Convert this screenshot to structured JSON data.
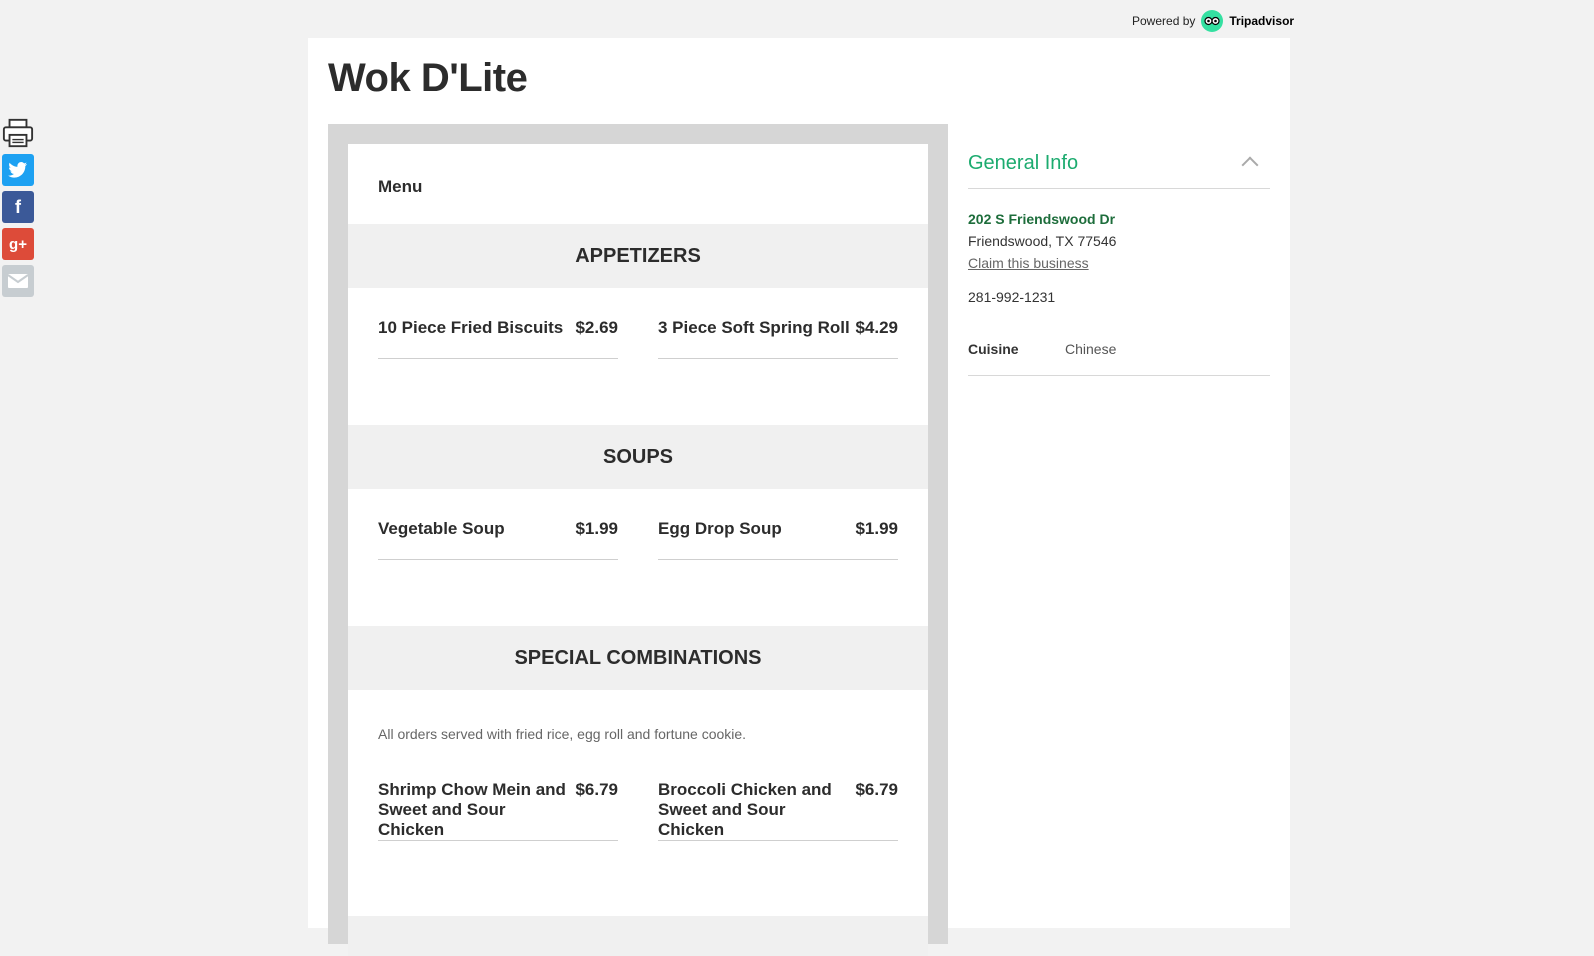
{
  "powered_by": {
    "label": "Powered by",
    "brand": "Tripadvisor"
  },
  "share": {
    "icons": [
      "printer-icon",
      "twitter-icon",
      "facebook-icon",
      "google-plus-icon",
      "email-icon"
    ],
    "twitter_glyph": "t",
    "facebook_glyph": "f",
    "googleplus_glyph": "g+"
  },
  "restaurant": {
    "name": "Wok D'Lite"
  },
  "menu": {
    "label": "Menu",
    "sections": [
      {
        "title": "APPETIZERS",
        "items": [
          {
            "name": "10 Piece Fried Biscuits",
            "price": "$2.69"
          },
          {
            "name": "3 Piece Soft Spring Roll",
            "price": "$4.29"
          }
        ]
      },
      {
        "title": "SOUPS",
        "items": [
          {
            "name": "Vegetable Soup",
            "price": "$1.99"
          },
          {
            "name": "Egg Drop Soup",
            "price": "$1.99"
          }
        ]
      },
      {
        "title": "SPECIAL COMBINATIONS",
        "note": "All orders served with fried rice, egg roll and fortune cookie.",
        "items": [
          {
            "name": "Shrimp Chow Mein and Sweet and Sour Chicken",
            "price": "$6.79"
          },
          {
            "name": "Broccoli Chicken and Sweet and Sour Chicken",
            "price": "$6.79"
          }
        ]
      }
    ]
  },
  "general_info": {
    "title": "General Info",
    "address_line1": "202 S Friendswood Dr",
    "address_line2": "Friendswood, TX 77546",
    "claim_link": "Claim this business",
    "phone": "281-992-1231",
    "cuisine_label": "Cuisine",
    "cuisine_value": "Chinese"
  },
  "colors": {
    "accent_green": "#1cab6f",
    "address_green": "#1d6d3b",
    "tripadvisor": "#34e0a1"
  }
}
